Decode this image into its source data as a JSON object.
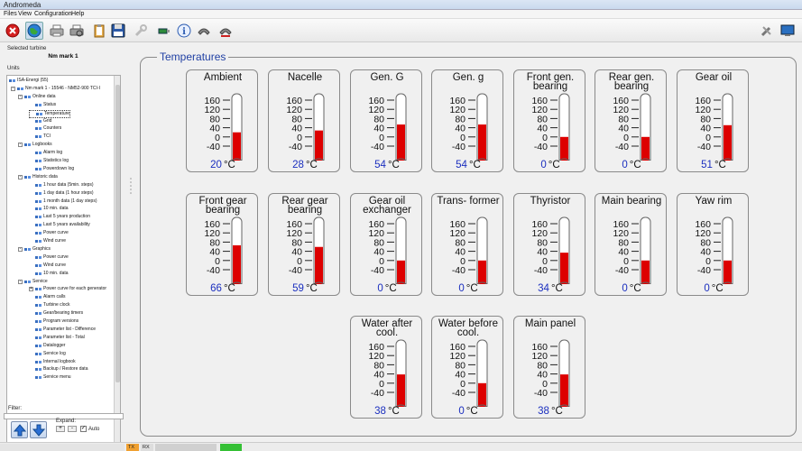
{
  "window": {
    "title": "Andromeda"
  },
  "menu": [
    "Files",
    "View",
    "Configuration",
    "Help"
  ],
  "toolbar_icons": [
    "close-icon",
    "globe-icon",
    "printer-icon",
    "print-preview-icon",
    "clipboard-icon",
    "save-icon",
    "wrench-icon",
    "usb-icon",
    "info-icon",
    "phone-icon",
    "phone-sync-icon",
    "tools-icon",
    "monitor-icon"
  ],
  "left": {
    "selected_label": "Selected turbine",
    "turbine_name": "Nm mark 1",
    "units_label": "Units",
    "tree": [
      {
        "label": "ISA-Energi (55)",
        "level": 0,
        "toggle": ""
      },
      {
        "label": "Nm mark 1 - 15546 - NM52-900 TCI-I",
        "level": 1,
        "toggle": "-"
      },
      {
        "label": "Online data",
        "level": 2,
        "toggle": "-"
      },
      {
        "label": "Status",
        "level": 3,
        "toggle": ""
      },
      {
        "label": "Temperature",
        "level": 3,
        "toggle": "",
        "selected": true
      },
      {
        "label": "Grid",
        "level": 3,
        "toggle": ""
      },
      {
        "label": "Counters",
        "level": 3,
        "toggle": ""
      },
      {
        "label": "TCI",
        "level": 3,
        "toggle": ""
      },
      {
        "label": "Logbooks",
        "level": 2,
        "toggle": "-"
      },
      {
        "label": "Alarm log",
        "level": 3,
        "toggle": ""
      },
      {
        "label": "Statistics log",
        "level": 3,
        "toggle": ""
      },
      {
        "label": "Powerdown log",
        "level": 3,
        "toggle": ""
      },
      {
        "label": "Historic data",
        "level": 2,
        "toggle": "-"
      },
      {
        "label": "1 hour data (5min. steps)",
        "level": 3,
        "toggle": ""
      },
      {
        "label": "1 day data (1 hour steps)",
        "level": 3,
        "toggle": ""
      },
      {
        "label": "1 month data (1 day steps)",
        "level": 3,
        "toggle": ""
      },
      {
        "label": "10 min. data",
        "level": 3,
        "toggle": ""
      },
      {
        "label": "Last 5 years production",
        "level": 3,
        "toggle": ""
      },
      {
        "label": "Last 5 years availability",
        "level": 3,
        "toggle": ""
      },
      {
        "label": "Power curve",
        "level": 3,
        "toggle": ""
      },
      {
        "label": "Wind curve",
        "level": 3,
        "toggle": ""
      },
      {
        "label": "Graphics",
        "level": 2,
        "toggle": "-"
      },
      {
        "label": "Power curve",
        "level": 3,
        "toggle": ""
      },
      {
        "label": "Wind curve",
        "level": 3,
        "toggle": ""
      },
      {
        "label": "10 min. data",
        "level": 3,
        "toggle": ""
      },
      {
        "label": "Service",
        "level": 2,
        "toggle": "-"
      },
      {
        "label": "Power curve for each generator",
        "level": 3,
        "toggle": "+"
      },
      {
        "label": "Alarm calls",
        "level": 3,
        "toggle": ""
      },
      {
        "label": "Turbine clock",
        "level": 3,
        "toggle": ""
      },
      {
        "label": "Gear/bearing timers",
        "level": 3,
        "toggle": ""
      },
      {
        "label": "Program versions",
        "level": 3,
        "toggle": ""
      },
      {
        "label": "Parameter list - Difference",
        "level": 3,
        "toggle": ""
      },
      {
        "label": "Parameter list - Total",
        "level": 3,
        "toggle": ""
      },
      {
        "label": "Datalogger",
        "level": 3,
        "toggle": ""
      },
      {
        "label": "Service log",
        "level": 3,
        "toggle": ""
      },
      {
        "label": "Internal logbook",
        "level": 3,
        "toggle": ""
      },
      {
        "label": "Backup / Restore data",
        "level": 3,
        "toggle": ""
      },
      {
        "label": "Service menu",
        "level": 3,
        "toggle": ""
      }
    ],
    "filter_label": "Filter:",
    "expand_label": "Expand:",
    "expand_plus": "+",
    "expand_minus": "-",
    "auto_label": "Auto",
    "auto_checked": true,
    "auto_check_glyph": "✓"
  },
  "status": {
    "tx": "TX",
    "rx": "RX",
    "connection_level": 1.0
  },
  "main": {
    "group_title": "Temperatures",
    "unit": "°C",
    "scale_ticks": [
      160,
      120,
      80,
      40,
      0,
      -40
    ],
    "scale_range": [
      -40,
      160
    ],
    "mercury_color": "#dd0000",
    "value_color": "#1b2fbf",
    "thermometers": [
      {
        "name": "Ambient",
        "value": 20
      },
      {
        "name": "Nacelle",
        "value": 28
      },
      {
        "name": "Gen. G",
        "value": 54
      },
      {
        "name": "Gen. g",
        "value": 54
      },
      {
        "name": "Front gen. bearing",
        "value": 0
      },
      {
        "name": "Rear gen. bearing",
        "value": 0
      },
      {
        "name": "Gear oil",
        "value": 51
      },
      {
        "name": "Front gear bearing",
        "value": 66
      },
      {
        "name": "Rear gear bearing",
        "value": 59
      },
      {
        "name": "Gear oil exchanger",
        "value": 0
      },
      {
        "name": "Trans- former",
        "value": 0
      },
      {
        "name": "Thyristor",
        "value": 34
      },
      {
        "name": "Main bearing",
        "value": 0
      },
      {
        "name": "Yaw rim",
        "value": 0
      },
      {
        "name": "Water after cool.",
        "value": 38
      },
      {
        "name": "Water before cool.",
        "value": 0
      },
      {
        "name": "Main panel",
        "value": 38
      }
    ]
  }
}
